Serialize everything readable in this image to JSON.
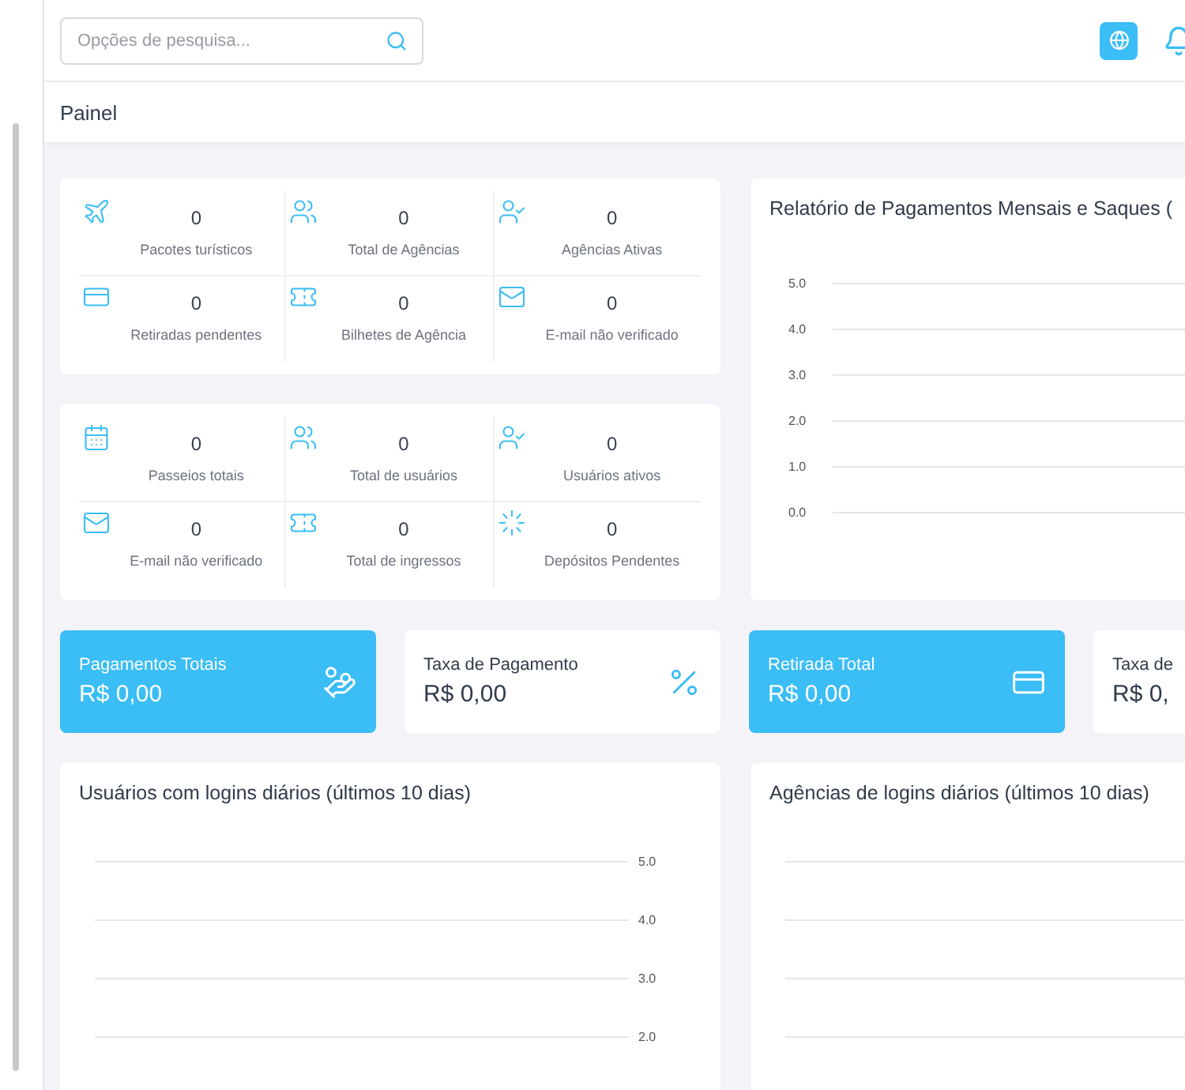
{
  "header": {
    "search": {
      "placeholder": "Opções de pesquisa..."
    }
  },
  "breadcrumb": "Painel",
  "stat_groups": [
    {
      "items": [
        {
          "value": "0",
          "label": "Pacotes turísticos"
        },
        {
          "value": "0",
          "label": "Total de Agências"
        },
        {
          "value": "0",
          "label": "Agências Ativas"
        },
        {
          "value": "0",
          "label": "Retiradas pendentes"
        },
        {
          "value": "0",
          "label": "Bilhetes de Agência"
        },
        {
          "value": "0",
          "label": "E-mail não verificado"
        }
      ]
    },
    {
      "items": [
        {
          "value": "0",
          "label": "Passeios totais"
        },
        {
          "value": "0",
          "label": "Total de usuários"
        },
        {
          "value": "0",
          "label": "Usuários ativos"
        },
        {
          "value": "0",
          "label": "E-mail não verificado"
        },
        {
          "value": "0",
          "label": "Total de ingressos"
        },
        {
          "value": "0",
          "label": "Depósitos Pendentes"
        }
      ]
    }
  ],
  "report_chart": {
    "title": "Relatório de Pagamentos Mensais e Saques (",
    "axis_labels": [
      "5.0",
      "4.0",
      "3.0",
      "2.0",
      "1.0",
      "0.0"
    ]
  },
  "summary_cards": [
    {
      "label": "Pagamentos Totais",
      "value": "R$ 0,00",
      "filled": true
    },
    {
      "label": "Taxa de Pagamento",
      "value": "R$ 0,00",
      "filled": false
    },
    {
      "label": "Retirada Total",
      "value": "R$ 0,00",
      "filled": true
    },
    {
      "label": "Taxa de",
      "value": "R$ 0,",
      "filled": false
    }
  ],
  "login_charts": [
    {
      "title": "Usuários com logins diários (últimos 10 dias)",
      "axis_labels": [
        "5.0",
        "4.0",
        "3.0",
        "2.0"
      ]
    },
    {
      "title": "Agências de logins diários (últimos 10 dias)"
    }
  ]
}
